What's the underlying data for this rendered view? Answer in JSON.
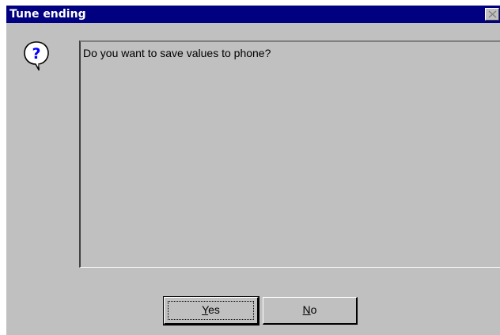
{
  "window": {
    "title": "Tune ending"
  },
  "dialog": {
    "message": "Do you want to save values to phone?",
    "icon": "question-icon"
  },
  "buttons": {
    "yes": {
      "mnemonic": "Y",
      "rest": "es"
    },
    "no": {
      "mnemonic": "N",
      "rest": "o"
    }
  },
  "colors": {
    "titlebar": "#000080",
    "face": "#c0c0c0"
  }
}
